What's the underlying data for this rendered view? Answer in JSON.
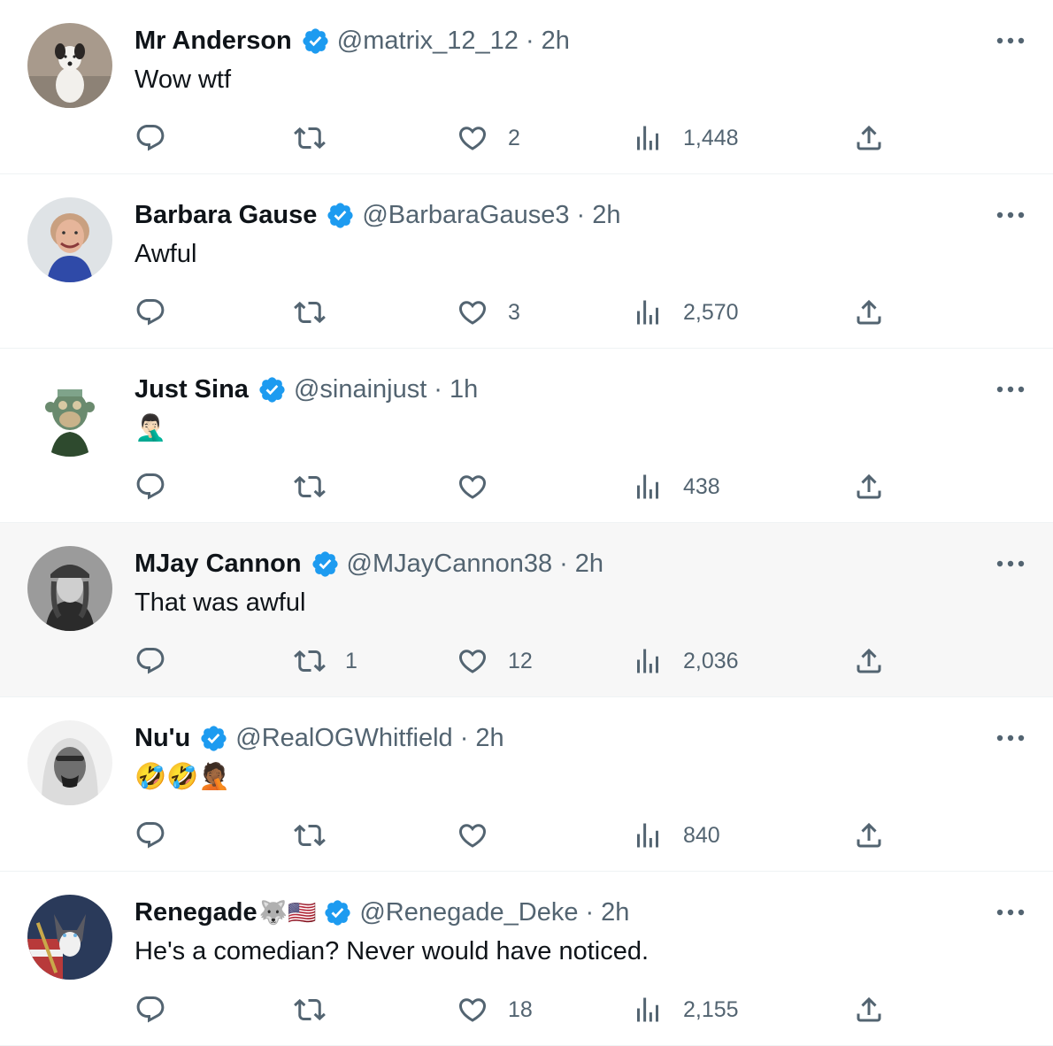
{
  "colors": {
    "verified": "#1d9bf0",
    "text": "#0f1419",
    "muted": "#536471",
    "divider": "#eff3f4",
    "hover_row": "#f7f7f7"
  },
  "tweets": [
    {
      "name": "Mr Anderson",
      "name_emoji": "",
      "handle": "@matrix_12_12",
      "separator": "·",
      "time": "2h",
      "text": "Wow wtf",
      "replies": "",
      "retweets": "",
      "likes": "2",
      "views": "1,448",
      "avatar": "dog-photo"
    },
    {
      "name": "Barbara Gause",
      "name_emoji": "",
      "handle": "@BarbaraGause3",
      "separator": "·",
      "time": "2h",
      "text": "Awful",
      "replies": "",
      "retweets": "",
      "likes": "3",
      "views": "2,570",
      "avatar": "woman-smiling-photo"
    },
    {
      "name": "Just Sina",
      "name_emoji": "",
      "handle": "@sinainjust",
      "separator": "·",
      "time": "1h",
      "text": "🤦🏻‍♂️",
      "replies": "",
      "retweets": "",
      "likes": "",
      "views": "438",
      "avatar": "ape-nft-art"
    },
    {
      "name": "MJay Cannon",
      "name_emoji": "",
      "handle": "@MJayCannon38",
      "separator": "·",
      "time": "2h",
      "text": "That was awful",
      "replies": "",
      "retweets": "1",
      "likes": "12",
      "views": "2,036",
      "avatar": "woman-cap-photo"
    },
    {
      "name": "Nu'u",
      "name_emoji": "",
      "handle": "@RealOGWhitfield",
      "separator": "·",
      "time": "2h",
      "text": "🤣🤣🤦🏾",
      "replies": "",
      "retweets": "",
      "likes": "",
      "views": "840",
      "avatar": "man-hood-photo"
    },
    {
      "name": "Renegade",
      "name_emoji": "🐺🇺🇸",
      "handle": "@Renegade_Deke",
      "separator": "·",
      "time": "2h",
      "text": "He's a comedian? Never would have noticed.",
      "replies": "",
      "retweets": "",
      "likes": "18",
      "views": "2,155",
      "avatar": "husky-flag-art"
    }
  ],
  "icons": {
    "verified": "verified-badge-icon",
    "more": "more-dots-icon",
    "reply": "reply-bubble-icon",
    "retweet": "retweet-arrows-icon",
    "like": "heart-icon",
    "views": "views-bar-chart-icon",
    "share": "share-upload-icon"
  }
}
